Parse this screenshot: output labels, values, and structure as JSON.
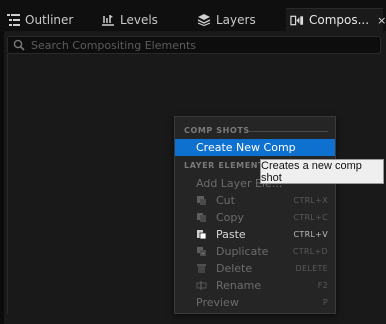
{
  "tabs": [
    {
      "label": "Outliner",
      "icon": "list-icon",
      "active": false
    },
    {
      "label": "Levels",
      "icon": "levels-icon",
      "active": false
    },
    {
      "label": "Layers",
      "icon": "layers-icon",
      "active": false
    },
    {
      "label": "Compos...",
      "icon": "composite-icon",
      "active": true,
      "close": "×"
    }
  ],
  "search": {
    "placeholder": "Search Compositing Elements",
    "value": ""
  },
  "context_menu": {
    "sections": [
      {
        "title": "COMP SHOTS"
      },
      {
        "title": "LAYER ELEMENTS"
      }
    ],
    "items": [
      {
        "label": "Create New Comp",
        "shortcut": "",
        "state": "highlighted",
        "icon": ""
      },
      {
        "label": "Add Layer Ele...",
        "shortcut": "",
        "state": "disabled",
        "icon": ""
      },
      {
        "label": "Cut",
        "shortcut": "CTRL+X",
        "state": "disabled",
        "icon": "cut-icon"
      },
      {
        "label": "Copy",
        "shortcut": "CTRL+C",
        "state": "disabled",
        "icon": "copy-icon"
      },
      {
        "label": "Paste",
        "shortcut": "CTRL+V",
        "state": "enabled",
        "icon": "paste-icon"
      },
      {
        "label": "Duplicate",
        "shortcut": "CTRL+D",
        "state": "disabled",
        "icon": "duplicate-icon"
      },
      {
        "label": "Delete",
        "shortcut": "DELETE",
        "state": "disabled",
        "icon": "delete-icon"
      },
      {
        "label": "Rename",
        "shortcut": "F2",
        "state": "disabled",
        "icon": "rename-icon"
      },
      {
        "label": "Preview",
        "shortcut": "P",
        "state": "disabled",
        "icon": ""
      }
    ]
  },
  "tooltip": {
    "text": "Creates a new comp shot"
  },
  "colors": {
    "highlight": "#0e71d0",
    "background": "#151515",
    "menu": "#252525"
  }
}
